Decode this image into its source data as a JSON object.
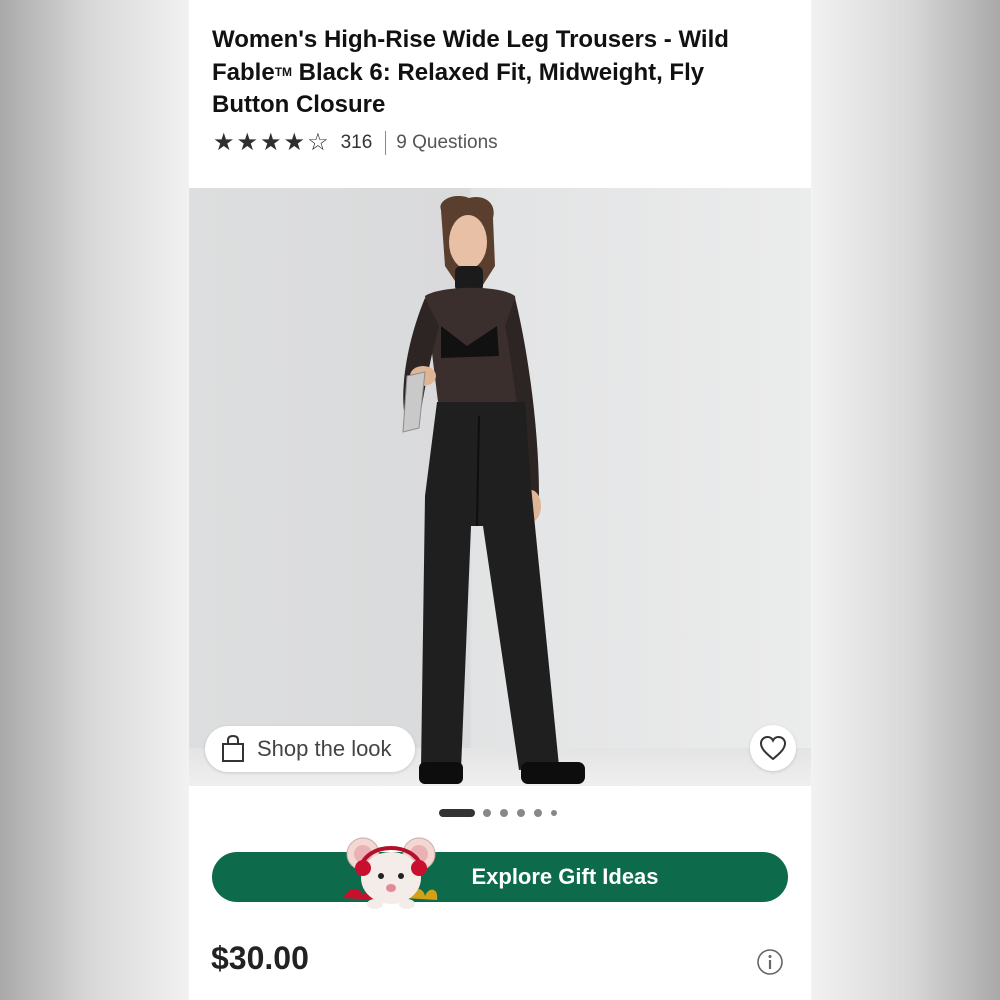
{
  "product": {
    "title_main": "Women's High-Rise Wide Leg Trousers - Wild Fable",
    "trademark": "TM",
    "title_rest": " Black 6: Relaxed Fit, Midweight, Fly Button Closure",
    "rating": {
      "value": 4,
      "max": 5,
      "count": "316",
      "questions": "9 Questions"
    },
    "price": "$30.00"
  },
  "gallery": {
    "shop_the_look": "Shop the look",
    "image_count": 6,
    "active_index": 0
  },
  "promo": {
    "button_label": "Explore Gift Ideas"
  },
  "icons": {
    "bag": "shopping-bag-icon",
    "heart": "heart-icon",
    "info": "info-icon",
    "star": "star-icon"
  },
  "colors": {
    "gift_button": "#0d6b4c",
    "text": "#111111",
    "stars": "#2f2f2f"
  }
}
